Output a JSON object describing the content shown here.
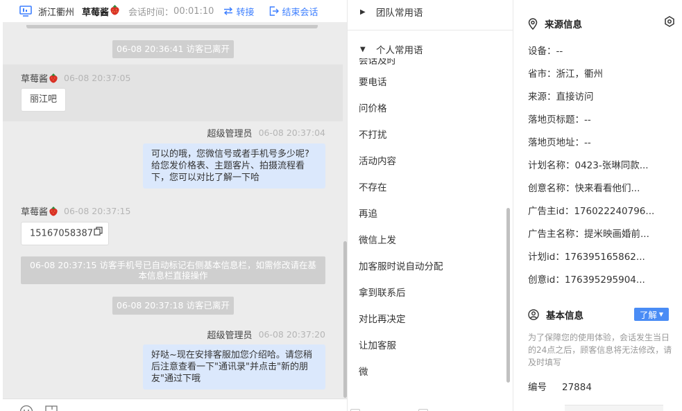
{
  "header": {
    "region": "浙江衢州",
    "visitor_name": "草莓酱",
    "timer_label": "会话时间：",
    "timer_value": "00:01:10",
    "transfer_label": "转接",
    "end_label": "结束会话"
  },
  "messages": {
    "sys1": "06-08 20:36:41 访客已离开",
    "m1_sender": "草莓酱",
    "m1_time": "06-08 20:37:05",
    "m1_text": "丽江吧",
    "m2_sender": "超级管理员",
    "m2_time": "06-08 20:37:04",
    "m2_line1": "可以的哦，您微信号或者手机号多少呢?",
    "m2_line2": "给您发价格表、主题客片、拍摄流程看",
    "m2_line3": "下，您可以对比了解一下哈",
    "m3_sender": "草莓酱",
    "m3_time": "06-08 20:37:15",
    "m3_text": "15167058387",
    "sys2_line1": "06-08 20:37:15 访客手机号已自动标记右侧基本信息栏，如需修改请在基",
    "sys2_line2": "本信息栏直接操作",
    "sys3": "06-08 20:37:18 访客已离开",
    "m4_sender": "超级管理员",
    "m4_time": "06-08 20:37:20",
    "m4_line1": "好哒~现在安排客服加您介绍哈。请您稍",
    "m4_line2": "后注意查看一下\"通讯录\"并点击\"新的朋",
    "m4_line3": "友\"通过下哦"
  },
  "phrases": {
    "group_team": "团队常用语",
    "group_personal": "个人常用语",
    "clipped_top": "会话及时",
    "items": [
      "要电话",
      "问价格",
      "不打扰",
      "活动内容",
      "不存在",
      "再追",
      "微信上发",
      "加客服时说自动分配",
      "拿到联系后",
      "对比再决定",
      "让加客服",
      "微"
    ]
  },
  "info": {
    "source_title": "来源信息",
    "rows": [
      {
        "k": "设备：",
        "v": "--"
      },
      {
        "k": "省市：",
        "v": "浙江，衢州"
      },
      {
        "k": "来源：",
        "v": "直接访问"
      },
      {
        "k": "落地页标题：",
        "v": "--"
      },
      {
        "k": "落地页地址：",
        "v": "--"
      },
      {
        "k": "计划名称：",
        "v": "0423-张琳同款..."
      },
      {
        "k": "创意名称：",
        "v": "快来看看他们..."
      },
      {
        "k": "广告主id：",
        "v": "176022240796..."
      },
      {
        "k": "广告主名称：",
        "v": "提米映画婚前..."
      },
      {
        "k": "计划id：",
        "v": "176395165862..."
      },
      {
        "k": "创意id：",
        "v": "176395295904..."
      }
    ],
    "basic_title": "基本信息",
    "learn_label": "了解",
    "notice": "为了保障您的使用体验，会话发生当日的24点之后，顾客信息将无法修改，请及时填写",
    "number_label": "编号",
    "number_value": "27884"
  },
  "colors": {
    "accent": "#3d7fff",
    "chat_bg": "#ececec",
    "agent_bubble": "#dbe8fc",
    "system_pill": "#cfcfcf"
  }
}
